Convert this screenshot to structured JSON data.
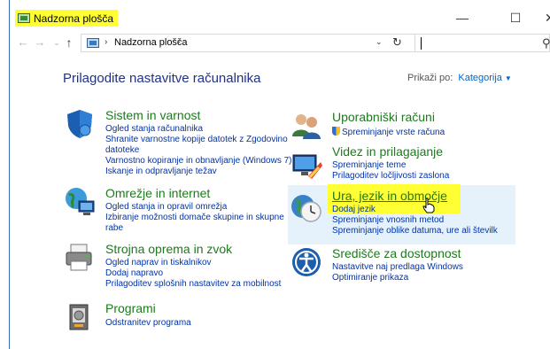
{
  "window": {
    "title": "Nadzorna plošča",
    "minimize": "—",
    "maximize": "☐",
    "close": "✕"
  },
  "nav": {
    "back": "←",
    "forward": "→",
    "recent": "⌄",
    "up": "↑",
    "breadcrumb": "Nadzorna plošča",
    "sep": "›",
    "dropdown": "⌄",
    "refresh": "↻",
    "search_placeholder": "",
    "search_glyph": "⚲"
  },
  "header": {
    "title": "Prilagodite nastavitve računalnika",
    "viewby_label": "Prikaži po:",
    "viewby_value": "Kategorija",
    "viewby_arrow": "▼"
  },
  "left_categories": [
    {
      "icon": "shield-icon",
      "title": "Sistem in varnost",
      "links": [
        "Ogled stanja računalnika",
        "Shranite varnostne kopije datotek z Zgodovino",
        "datoteke",
        "Varnostno kopiranje in obnavljanje (Windows 7)",
        "Iskanje in odpravljanje težav"
      ]
    },
    {
      "icon": "network-icon",
      "title": "Omrežje in internet",
      "links": [
        "Ogled stanja in opravil omrežja",
        "Izbiranje možnosti domače skupine in skupne",
        "rabe"
      ]
    },
    {
      "icon": "printer-icon",
      "title": "Strojna oprema in zvok",
      "links": [
        "Ogled naprav in tiskalnikov",
        "Dodaj napravo",
        "Prilagoditev splošnih nastavitev za mobilnost"
      ]
    },
    {
      "icon": "programs-icon",
      "title": "Programi",
      "links": [
        "Odstranitev programa"
      ]
    }
  ],
  "right_categories": [
    {
      "icon": "users-icon",
      "title": "Uporabniški računi",
      "links": [
        "Spreminjanje vrste računa"
      ]
    },
    {
      "icon": "appearance-icon",
      "title": "Videz in prilagajanje",
      "links": [
        "Spreminjanje teme",
        "Prilagoditev ločljivosti zaslona"
      ]
    },
    {
      "icon": "clock-globe-icon",
      "title": "Ura, jezik in območje",
      "links": [
        "Dodaj jezik",
        "Spreminjanje vnosnih metod",
        "Spreminjanje oblike datuma, ure ali številk"
      ]
    },
    {
      "icon": "accessibility-icon",
      "title": "Središče za dostopnost",
      "links": [
        "Nastavitve naj predlaga Windows",
        "Optimiranje prikaza"
      ]
    }
  ],
  "colors": {
    "category_title": "#1d7a1d",
    "link": "#0033aa",
    "heading": "#1e3287",
    "highlight": "#ffff33",
    "hover": "#e5f1fb"
  }
}
